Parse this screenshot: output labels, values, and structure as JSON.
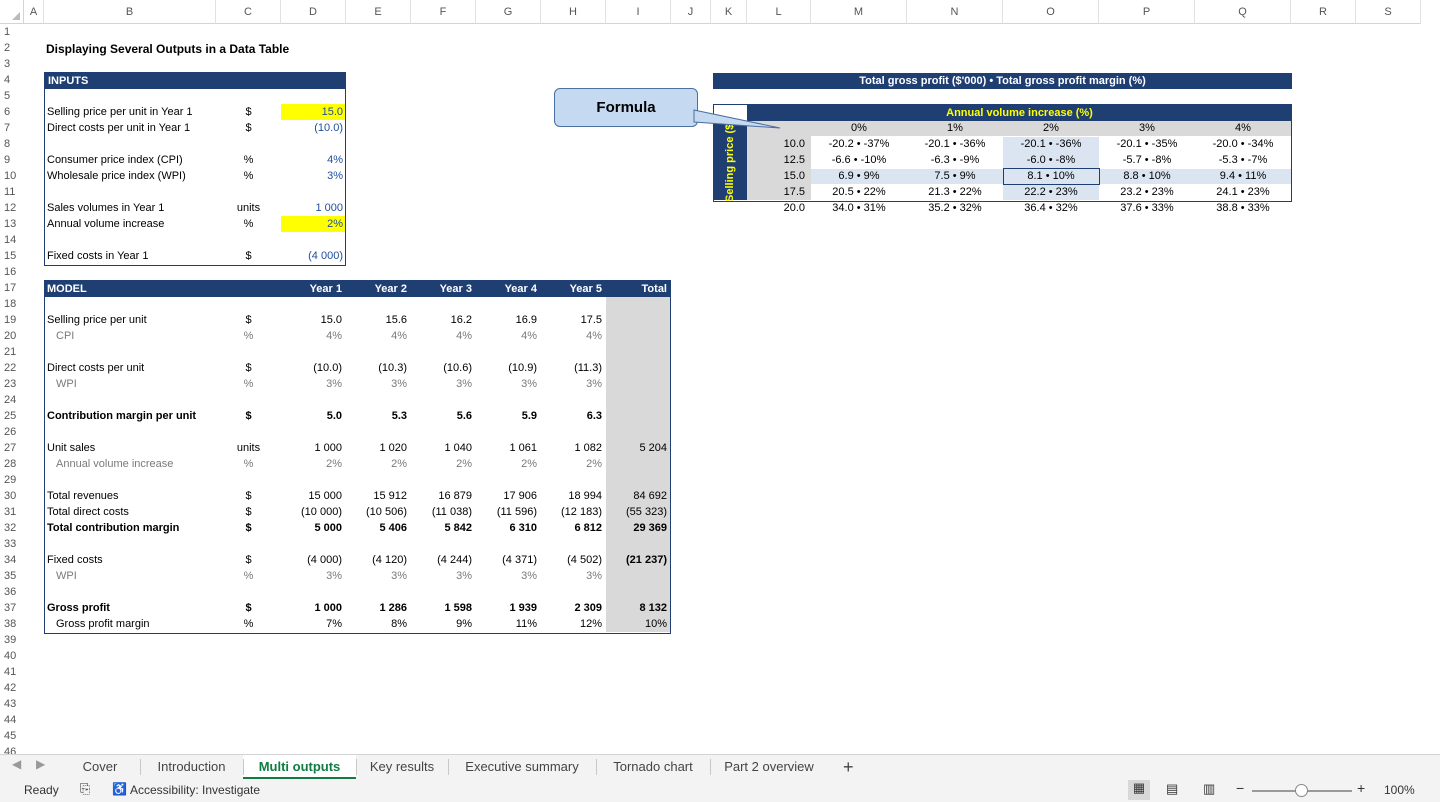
{
  "columns": [
    "A",
    "B",
    "C",
    "D",
    "E",
    "F",
    "G",
    "H",
    "I",
    "J",
    "K",
    "L",
    "M",
    "N",
    "O",
    "P",
    "Q",
    "R",
    "S"
  ],
  "rows": [
    "1",
    "2",
    "3",
    "4",
    "5",
    "6",
    "7",
    "8",
    "9",
    "10",
    "11",
    "12",
    "13",
    "14",
    "15",
    "16",
    "17",
    "18",
    "19",
    "20",
    "21",
    "22",
    "23",
    "24",
    "25",
    "26",
    "27",
    "28",
    "29",
    "30",
    "31",
    "32",
    "33",
    "34",
    "35",
    "36",
    "37",
    "38",
    "39",
    "40",
    "41",
    "42",
    "43",
    "44",
    "45",
    "46"
  ],
  "title": "Displaying Several Outputs in a Data Table",
  "inputs": {
    "header": "INPUTS",
    "rows": [
      {
        "row": 6,
        "label": "Selling price per unit in Year 1",
        "unit": "$",
        "value": "15.0",
        "highlight": true
      },
      {
        "row": 7,
        "label": "Direct costs per unit in Year 1",
        "unit": "$",
        "value": "(10.0)",
        "highlight": false
      },
      {
        "row": 9,
        "label": "Consumer price index (CPI)",
        "unit": "%",
        "value": "4%",
        "highlight": false
      },
      {
        "row": 10,
        "label": "Wholesale price index (WPI)",
        "unit": "%",
        "value": "3%",
        "highlight": false
      },
      {
        "row": 12,
        "label": "Sales volumes in Year 1",
        "unit": "units",
        "value": "1 000",
        "highlight": false
      },
      {
        "row": 13,
        "label": "Annual volume increase",
        "unit": "%",
        "value": "2%",
        "highlight": true
      },
      {
        "row": 15,
        "label": "Fixed costs in Year 1",
        "unit": "$",
        "value": "(4 000)",
        "highlight": false
      }
    ]
  },
  "model": {
    "header": "MODEL",
    "years": [
      "Year 1",
      "Year 2",
      "Year 3",
      "Year 4",
      "Year 5"
    ],
    "total_label": "Total",
    "rows": [
      {
        "row": 19,
        "label": "Selling price per unit",
        "unit": "$",
        "vals": [
          "15.0",
          "15.6",
          "16.2",
          "16.9",
          "17.5"
        ],
        "total": "",
        "style": "normal"
      },
      {
        "row": 20,
        "label": "CPI",
        "unit": "%",
        "vals": [
          "4%",
          "4%",
          "4%",
          "4%",
          "4%"
        ],
        "total": "",
        "style": "sub"
      },
      {
        "row": 22,
        "label": "Direct costs per unit",
        "unit": "$",
        "vals": [
          "(10.0)",
          "(10.3)",
          "(10.6)",
          "(10.9)",
          "(11.3)"
        ],
        "total": "",
        "style": "normal"
      },
      {
        "row": 23,
        "label": "WPI",
        "unit": "%",
        "vals": [
          "3%",
          "3%",
          "3%",
          "3%",
          "3%"
        ],
        "total": "",
        "style": "sub"
      },
      {
        "row": 25,
        "label": "Contribution margin per unit",
        "unit": "$",
        "vals": [
          "5.0",
          "5.3",
          "5.6",
          "5.9",
          "6.3"
        ],
        "total": "",
        "style": "bold"
      },
      {
        "row": 27,
        "label": "Unit sales",
        "unit": "units",
        "vals": [
          "1 000",
          "1 020",
          "1 040",
          "1 061",
          "1 082"
        ],
        "total": "5 204",
        "style": "normal"
      },
      {
        "row": 28,
        "label": "Annual volume increase",
        "unit": "%",
        "vals": [
          "2%",
          "2%",
          "2%",
          "2%",
          "2%"
        ],
        "total": "",
        "style": "sub"
      },
      {
        "row": 30,
        "label": "Total revenues",
        "unit": "$",
        "vals": [
          "15 000",
          "15 912",
          "16 879",
          "17 906",
          "18 994"
        ],
        "total": "84 692",
        "style": "normal"
      },
      {
        "row": 31,
        "label": "Total direct costs",
        "unit": "$",
        "vals": [
          "(10 000)",
          "(10 506)",
          "(11 038)",
          "(11 596)",
          "(12 183)"
        ],
        "total": "(55 323)",
        "style": "normal"
      },
      {
        "row": 32,
        "label": "Total contribution margin",
        "unit": "$",
        "vals": [
          "5 000",
          "5 406",
          "5 842",
          "6 310",
          "6 812"
        ],
        "total": "29 369",
        "style": "bold"
      },
      {
        "row": 34,
        "label": "Fixed costs",
        "unit": "$",
        "vals": [
          "(4 000)",
          "(4 120)",
          "(4 244)",
          "(4 371)",
          "(4 502)"
        ],
        "total": "(21 237)",
        "style": "normal-totbold"
      },
      {
        "row": 35,
        "label": "WPI",
        "unit": "%",
        "vals": [
          "3%",
          "3%",
          "3%",
          "3%",
          "3%"
        ],
        "total": "",
        "style": "sub"
      },
      {
        "row": 37,
        "label": "Gross profit",
        "unit": "$",
        "vals": [
          "1 000",
          "1 286",
          "1 598",
          "1 939",
          "2 309"
        ],
        "total": "8 132",
        "style": "bold"
      },
      {
        "row": 38,
        "label": "Gross profit margin",
        "unit": "%",
        "vals": [
          "7%",
          "8%",
          "9%",
          "11%",
          "12%"
        ],
        "total": "10%",
        "style": "subdark"
      }
    ]
  },
  "datatable": {
    "title": "Total gross profit ($'000) • Total gross profit margin (%)",
    "col_header": "Annual volume increase (%)",
    "row_header": "Selling price ($)",
    "cols": [
      "0%",
      "1%",
      "2%",
      "3%",
      "4%"
    ],
    "rows": [
      {
        "price": "10.0",
        "cells": [
          "-20.2 • -37%",
          "-20.1 • -36%",
          "-20.1 • -36%",
          "-20.1 • -35%",
          "-20.0 • -34%"
        ]
      },
      {
        "price": "12.5",
        "cells": [
          "-6.6 • -10%",
          "-6.3 • -9%",
          "-6.0 • -8%",
          "-5.7 • -8%",
          "-5.3 • -7%"
        ]
      },
      {
        "price": "15.0",
        "cells": [
          "6.9 • 9%",
          "7.5 • 9%",
          "8.1 • 10%",
          "8.8 • 10%",
          "9.4 • 11%"
        ]
      },
      {
        "price": "17.5",
        "cells": [
          "20.5 • 22%",
          "21.3 • 22%",
          "22.2 • 23%",
          "23.2 • 23%",
          "24.1 • 23%"
        ]
      },
      {
        "price": "20.0",
        "cells": [
          "34.0 • 31%",
          "35.2 • 32%",
          "36.4 • 32%",
          "37.6 • 33%",
          "38.8 • 33%"
        ]
      }
    ]
  },
  "callout": "Formula",
  "sheet_tabs": [
    "Cover",
    "Introduction",
    "Multi outputs",
    "Key results",
    "Executive summary",
    "Tornado chart",
    "Part 2 overview"
  ],
  "active_tab": "Multi outputs",
  "status": {
    "ready": "Ready",
    "accessibility": "Accessibility: Investigate",
    "zoom": "100%"
  },
  "colors": {
    "navy": "#1f3f73",
    "highlight": "#ffff00",
    "header_text": "#ffff00",
    "active_tab": "#107c41",
    "input_blue": "#1f4e9c"
  }
}
